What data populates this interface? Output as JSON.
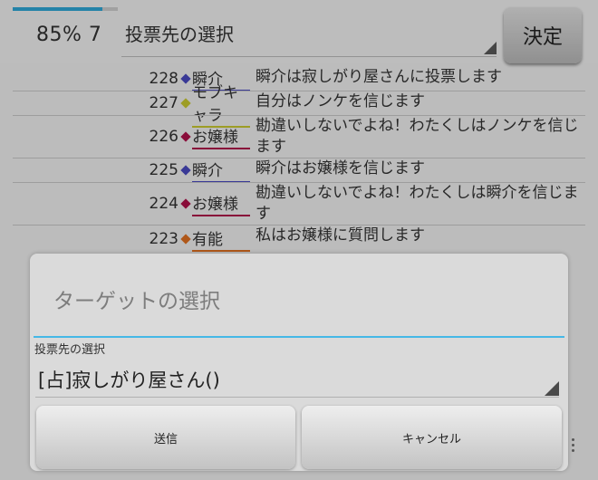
{
  "header": {
    "progress": 0.85,
    "status": "85% 7",
    "vote_select_label": "投票先の選択",
    "decide_label": "決定"
  },
  "log": [
    {
      "num": "228",
      "name": "瞬介",
      "color": "#4a4ac0",
      "msg": "瞬介は寂しがり屋さんに投票します"
    },
    {
      "num": "227",
      "name": "モブキャラ",
      "color": "#c9c930",
      "msg": "自分はノンケを信じます"
    },
    {
      "num": "226",
      "name": "お嬢様",
      "color": "#b0104a",
      "msg": "勘違いしないでよね！わたくしはノンケを信じます"
    },
    {
      "num": "225",
      "name": "瞬介",
      "color": "#4a4ac0",
      "msg": "瞬介はお嬢様を信じます"
    },
    {
      "num": "224",
      "name": "お嬢様",
      "color": "#b0104a",
      "msg": "勘違いしないでよね！わたくしは瞬介を信じます"
    },
    {
      "num": "223",
      "name": "有能",
      "color": "#e07020",
      "msg": "私はお嬢様に質問します"
    }
  ],
  "dialog": {
    "title": "ターゲットの選択",
    "field_label": "投票先の選択",
    "selected_target": "[占]寂しがり屋さん()",
    "send_label": "送信",
    "cancel_label": "キャンセル"
  }
}
